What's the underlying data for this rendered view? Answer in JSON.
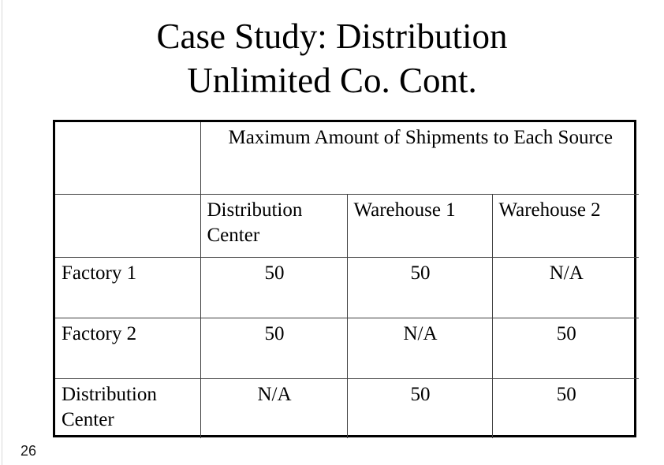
{
  "slide": {
    "title_line1": "Case Study: Distribution",
    "title_line2": "Unlimited Co. Cont.",
    "page_number": "26",
    "colors": {
      "text": "#000000",
      "table_outer_border": "#000000",
      "table_inner_border": "#404040",
      "background": "#ffffff",
      "edge_rule": "#d9d9d9"
    }
  },
  "table": {
    "group_header": "Maximum Amount of Shipments to Each Source",
    "corner_blank_top": "",
    "corner_blank_sub": "",
    "column_headers": [
      "Distribution Center",
      "Warehouse 1",
      "Warehouse 2"
    ],
    "rows": [
      {
        "label": "Factory 1",
        "values": [
          "50",
          "50",
          "N/A"
        ]
      },
      {
        "label": "Factory 2",
        "values": [
          "50",
          "N/A",
          "50"
        ]
      },
      {
        "label": "Distribution Center",
        "values": [
          "N/A",
          "50",
          "50"
        ]
      }
    ]
  }
}
